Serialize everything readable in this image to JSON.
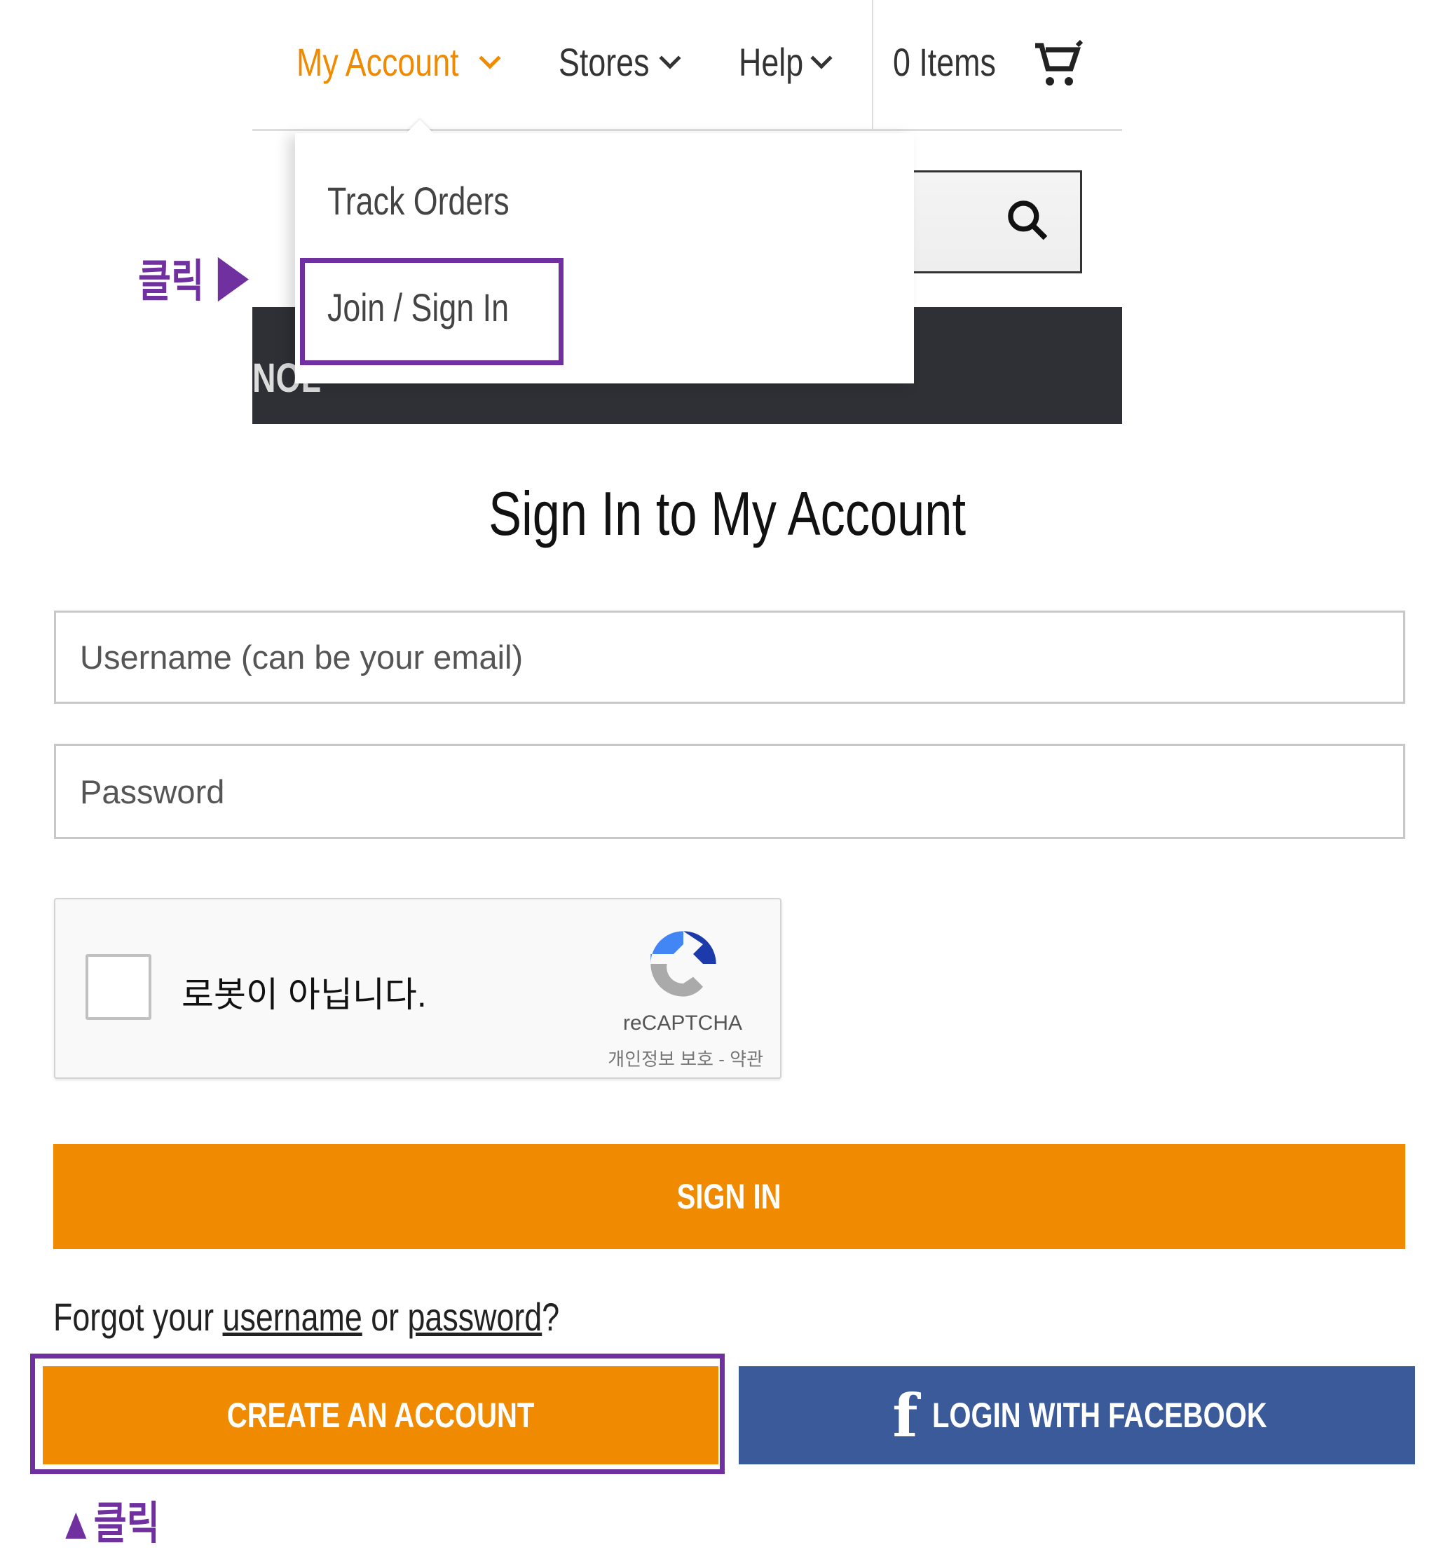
{
  "nav": {
    "my_account": "My Account",
    "stores": "Stores",
    "help": "Help",
    "cart_count": "0 Items"
  },
  "dropdown": {
    "items": [
      "Track Orders",
      "Join / Sign In"
    ]
  },
  "banner": {
    "partial_text": "NOL"
  },
  "annotations": {
    "click_arrow_right": "클릭 ▶",
    "click_arrow_up": "▲클릭",
    "highlight_color": "#7030a0"
  },
  "form": {
    "title": "Sign In to My Account",
    "username_placeholder": "Username (can be your email)",
    "password_placeholder": "Password",
    "sign_in": "SIGN IN"
  },
  "recaptcha": {
    "label": "로봇이 아닙니다.",
    "brand": "reCAPTCHA",
    "links": "개인정보 보호 - 약관"
  },
  "forgot": {
    "prefix": "Forgot your ",
    "username": "username",
    "mid": " or ",
    "password": "password",
    "suffix": "?"
  },
  "buttons": {
    "create_account": "CREATE AN ACCOUNT",
    "facebook": "LOGIN WITH FACEBOOK"
  },
  "colors": {
    "accent": "#f08a00",
    "facebook": "#3b5a9a",
    "dark_bar": "#2f3035"
  }
}
